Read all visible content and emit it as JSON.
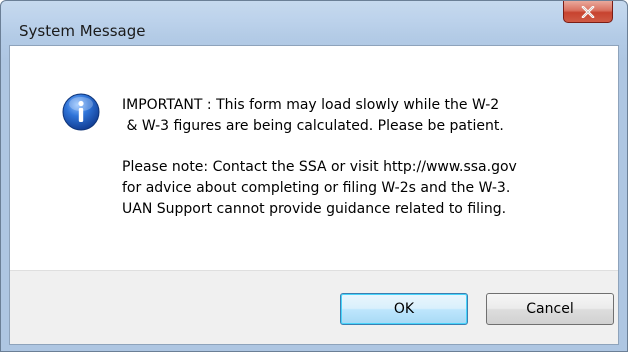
{
  "window": {
    "title": "System Message"
  },
  "message": {
    "lines": [
      "IMPORTANT : This form may load slowly while the W-2",
      " & W-3 figures are being calculated. Please be patient.",
      "Please note: Contact the SSA or visit http://www.ssa.gov",
      "for advice about completing or filing W-2s and the W-3.",
      "UAN Support cannot provide guidance related to filing."
    ]
  },
  "buttons": {
    "ok_label": "OK",
    "cancel_label": "Cancel"
  },
  "icons": {
    "message_icon": "info-icon",
    "close_icon": "close-icon"
  },
  "colors": {
    "close_button": "#c7432f",
    "info_icon": "#1f5fc0",
    "title_bar": "#b9d1ea"
  }
}
